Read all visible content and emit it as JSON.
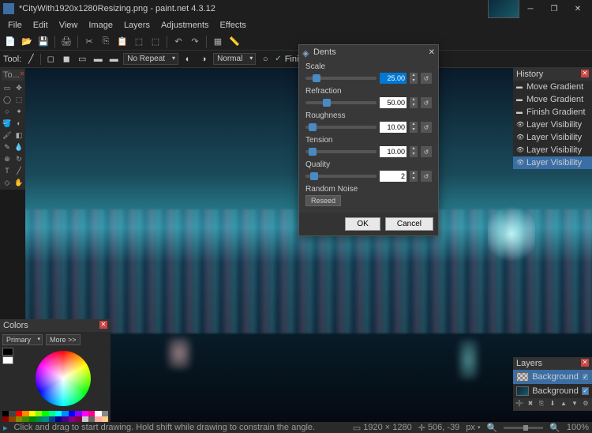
{
  "window": {
    "title": "*CityWith1920x1280Resizing.png - paint.net 4.3.12",
    "minimize": "─",
    "maximize": "❐",
    "close": "✕"
  },
  "menu": [
    "File",
    "Edit",
    "View",
    "Image",
    "Layers",
    "Adjustments",
    "Effects"
  ],
  "toolbar2": {
    "tool_label": "Tool:",
    "norepeat": "No Repeat",
    "blend": "Normal",
    "finish": "Finish"
  },
  "toolbox": {
    "title": "To..."
  },
  "dialog": {
    "title": "Dents",
    "params": [
      {
        "label": "Scale",
        "value": "25.00",
        "pos": 15,
        "selected": true
      },
      {
        "label": "Refraction",
        "value": "50.00",
        "pos": 30
      },
      {
        "label": "Roughness",
        "value": "10.00",
        "pos": 10
      },
      {
        "label": "Tension",
        "value": "10.00",
        "pos": 10
      },
      {
        "label": "Quality",
        "value": "2",
        "pos": 12
      }
    ],
    "random_label": "Random Noise",
    "reseed": "Reseed",
    "ok": "OK",
    "cancel": "Cancel"
  },
  "history": {
    "title": "History",
    "items": [
      {
        "label": "Move Gradient",
        "icon": "▬"
      },
      {
        "label": "Move Gradient",
        "icon": "▬"
      },
      {
        "label": "Finish Gradient",
        "icon": "▬"
      },
      {
        "label": "Layer Visibility",
        "icon": "👁"
      },
      {
        "label": "Layer Visibility",
        "icon": "👁"
      },
      {
        "label": "Layer Visibility",
        "icon": "👁"
      },
      {
        "label": "Layer Visibility",
        "icon": "👁",
        "selected": true
      }
    ]
  },
  "layers": {
    "title": "Layers",
    "items": [
      {
        "label": "Background",
        "checker": true,
        "selected": true
      },
      {
        "label": "Background",
        "checker": false
      }
    ]
  },
  "colors": {
    "title": "Colors",
    "primary": "Primary",
    "more": "More >>"
  },
  "status": {
    "msg": "Click and drag to start drawing. Hold shift while drawing to constrain the angle.",
    "size": "1920 × 1280",
    "cursor": "506, -39",
    "unit": "px",
    "zoom": "100%"
  },
  "palette_colors": [
    "#000",
    "#444",
    "#f00",
    "#f80",
    "#ff0",
    "#8f0",
    "#0f0",
    "#0f8",
    "#0ff",
    "#08f",
    "#00f",
    "#80f",
    "#f0f",
    "#f08",
    "#fff",
    "#888",
    "#800",
    "#840",
    "#880",
    "#480",
    "#080",
    "#084",
    "#088",
    "#048",
    "#008",
    "#408",
    "#808",
    "#804",
    "#ccc",
    "#666",
    "#faa",
    "#fc8"
  ]
}
